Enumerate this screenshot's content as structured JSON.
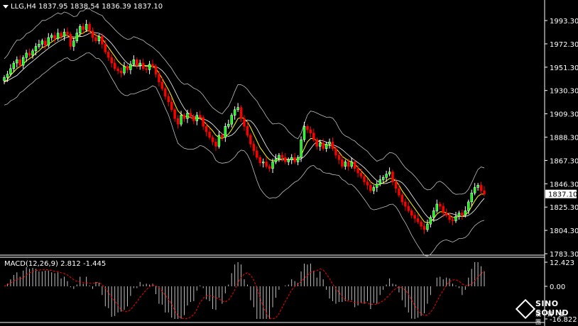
{
  "header": {
    "symbol": "LLG,H4",
    "open": "1837.95",
    "high": "1838.54",
    "low": "1836.39",
    "close": "1837.10"
  },
  "macd": {
    "label": "MACD(12,26,9)",
    "main": "2.812",
    "signal": "-1.445",
    "scale": [
      "12.423",
      "0.00",
      "-16.822"
    ],
    "range": [
      -16.822,
      12.423
    ]
  },
  "logo": {
    "name": "SINO SOUND",
    "sub": "漢 聲 集 團"
  },
  "colors": {
    "bull": "#ffffff",
    "bear": "#ff0000",
    "candle_bull_body": "#00ff00",
    "ma": "#ffff00",
    "bands": "#c0c0c0",
    "macd_hist": "#c0c0c0",
    "macd_signal": "#ff0000"
  },
  "chart_data": {
    "type": "candlestick",
    "ylim": [
      1783.3,
      2000.0
    ],
    "yticks": [
      "1993.30",
      "1972.30",
      "1951.30",
      "1930.30",
      "1909.30",
      "1888.30",
      "1867.30",
      "1846.30",
      "1825.30",
      "1804.30",
      "1783.30"
    ],
    "last_price": "1837.10",
    "closes": [
      1942,
      1945,
      1950,
      1955,
      1958,
      1953,
      1960,
      1964,
      1962,
      1966,
      1970,
      1972,
      1975,
      1971,
      1978,
      1980,
      1977,
      1982,
      1979,
      1983,
      1981,
      1970,
      1975,
      1982,
      1988,
      1985,
      1990,
      1984,
      1978,
      1975,
      1979,
      1972,
      1965,
      1960,
      1955,
      1950,
      1948,
      1946,
      1952,
      1949,
      1954,
      1958,
      1953,
      1955,
      1950,
      1949,
      1954,
      1952,
      1945,
      1938,
      1932,
      1925,
      1920,
      1913,
      1905,
      1900,
      1908,
      1905,
      1910,
      1907,
      1903,
      1908,
      1906,
      1898,
      1893,
      1888,
      1884,
      1880,
      1890,
      1888,
      1898,
      1900,
      1908,
      1913,
      1915,
      1905,
      1898,
      1890,
      1882,
      1876,
      1870,
      1865,
      1866,
      1862,
      1860,
      1866,
      1869,
      1872,
      1870,
      1866,
      1868,
      1870,
      1866,
      1870,
      1886,
      1898,
      1895,
      1892,
      1886,
      1880,
      1883,
      1878,
      1882,
      1884,
      1878,
      1872,
      1868,
      1862,
      1866,
      1862,
      1866,
      1860,
      1856,
      1853,
      1848,
      1845,
      1840,
      1843,
      1846,
      1850,
      1852,
      1855,
      1857,
      1848,
      1842,
      1836,
      1830,
      1826,
      1822,
      1818,
      1815,
      1812,
      1808,
      1805,
      1810,
      1816,
      1822,
      1828,
      1826,
      1820,
      1818,
      1814,
      1813,
      1817,
      1820,
      1818,
      1822,
      1830,
      1838,
      1843,
      1845,
      1840,
      1837.1
    ],
    "ma": [
      1938,
      1940,
      1944,
      1947,
      1950,
      1952,
      1954,
      1957,
      1959,
      1961,
      1964,
      1966,
      1969,
      1970,
      1972,
      1974,
      1976,
      1978,
      1978,
      1980,
      1980,
      1978,
      1977,
      1978,
      1981,
      1982,
      1984,
      1984,
      1982,
      1980,
      1979,
      1977,
      1973,
      1969,
      1965,
      1961,
      1957,
      1954,
      1952,
      1951,
      1952,
      1953,
      1953,
      1953,
      1953,
      1952,
      1952,
      1952,
      1950,
      1946,
      1941,
      1936,
      1931,
      1925,
      1918,
      1912,
      1909,
      1907,
      1907,
      1906,
      1905,
      1905,
      1905,
      1903,
      1900,
      1897,
      1894,
      1890,
      1888,
      1887,
      1889,
      1891,
      1895,
      1900,
      1905,
      1906,
      1905,
      1902,
      1897,
      1891,
      1885,
      1879,
      1875,
      1871,
      1868,
      1867,
      1867,
      1868,
      1869,
      1869,
      1868,
      1868,
      1868,
      1868,
      1872,
      1878,
      1884,
      1887,
      1887,
      1885,
      1884,
      1882,
      1881,
      1881,
      1880,
      1878,
      1875,
      1871,
      1869,
      1867,
      1866,
      1864,
      1861,
      1858,
      1855,
      1852,
      1848,
      1846,
      1845,
      1846,
      1847,
      1849,
      1851,
      1851,
      1849,
      1845,
      1840,
      1836,
      1832,
      1828,
      1824,
      1820,
      1816,
      1812,
      1811,
      1812,
      1815,
      1819,
      1821,
      1821,
      1820,
      1818,
      1816,
      1816,
      1817,
      1817,
      1818,
      1821,
      1826,
      1831,
      1835,
      1837,
      1837
    ]
  }
}
